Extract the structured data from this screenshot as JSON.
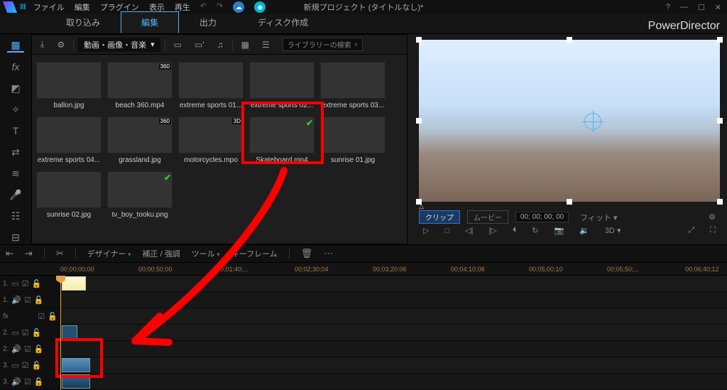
{
  "menu": {
    "file": "ファイル",
    "edit": "編集",
    "plugin": "プラグイン",
    "view": "表示",
    "play": "再生"
  },
  "title": "新規プロジェクト (タイトルなし)*",
  "help_icon": "?",
  "branding": "PowerDirector",
  "tabs": {
    "capture": "取り込み",
    "edit": "編集",
    "output": "出力",
    "disc": "ディスク作成"
  },
  "media_toolbar": {
    "dropdown": "動画・画像・音楽",
    "search_placeholder": "ライブラリーの検索"
  },
  "media": [
    {
      "label": "ballon.jpg"
    },
    {
      "label": "beach 360.mp4",
      "badge": "360"
    },
    {
      "label": "extreme sports 01..."
    },
    {
      "label": "extreme sports 02..."
    },
    {
      "label": "extreme sports 03..."
    },
    {
      "label": "extreme sports 04..."
    },
    {
      "label": "grassland.jpg",
      "badge": "360"
    },
    {
      "label": "motorcycles.mpo",
      "badge": "3D"
    },
    {
      "label": "Skateboard.mp4",
      "check": true
    },
    {
      "label": "sunrise 01.jpg"
    },
    {
      "label": "sunrise 02.jpg"
    },
    {
      "label": "tv_boy_tooku.png",
      "check": true
    }
  ],
  "preview": {
    "seg_clip": "クリップ",
    "seg_movie": "ムービー",
    "timecode": "00; 00; 00; 00",
    "fit": "フィット",
    "threeD": "3D"
  },
  "timeline_toolbar": {
    "designer": "デザイナー",
    "fix": "補正 / 強調",
    "tool": "ツール",
    "keyframe": "キーフレーム"
  },
  "ruler": [
    "00;00;00;00",
    "00;00;50;00",
    "00;01;40;...",
    "00;02;30;04",
    "00;03;20;06",
    "00;04;10;08",
    "00;05;00;10",
    "00;05;50;...",
    "00;06;40;12"
  ],
  "tracks": {
    "v1": "1.",
    "a1": "1.",
    "fx": "fx",
    "v2": "2.",
    "a2": "2.",
    "v3": "3.",
    "a3": "3."
  }
}
